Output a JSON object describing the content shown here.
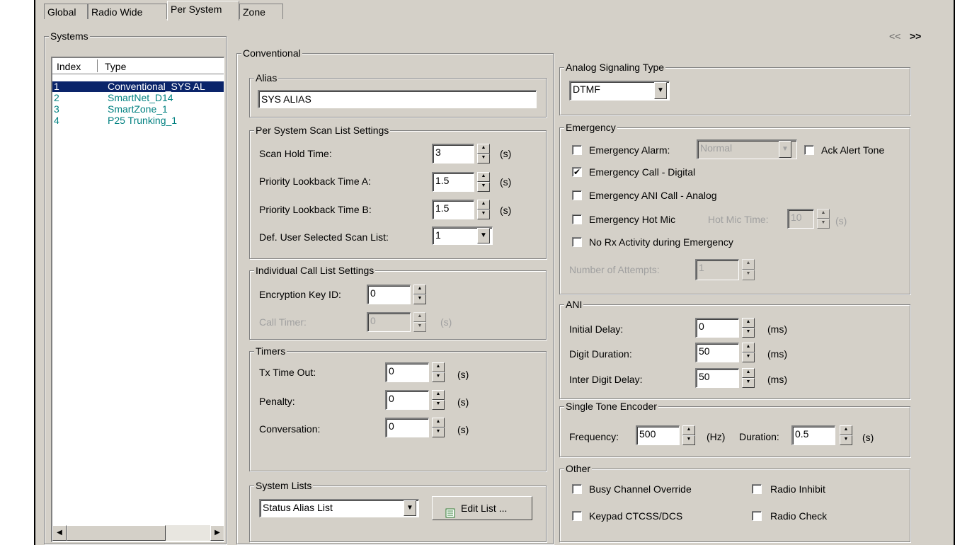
{
  "tabs": [
    "Global",
    "Radio Wide",
    "Per System",
    "Zone"
  ],
  "active_tab": "Per System",
  "nav": {
    "prev": "<<",
    "next": ">>"
  },
  "systems": {
    "title": "Systems",
    "columns": [
      "Index",
      "Type"
    ],
    "rows": [
      {
        "index": "1",
        "type": "Conventional_SYS AL"
      },
      {
        "index": "2",
        "type": "SmartNet_D14"
      },
      {
        "index": "3",
        "type": "SmartZone_1"
      },
      {
        "index": "4",
        "type": "P25 Trunking_1"
      }
    ]
  },
  "conventional": {
    "title": "Conventional",
    "alias": {
      "title": "Alias",
      "value": "SYS ALIAS"
    },
    "scan": {
      "title": "Per System Scan List Settings",
      "hold_label": "Scan Hold Time:",
      "hold_value": "3",
      "hold_unit": "(s)",
      "pa_label": "Priority Lookback Time A:",
      "pa_value": "1.5",
      "pa_unit": "(s)",
      "pb_label": "Priority Lookback Time B:",
      "pb_value": "1.5",
      "pb_unit": "(s)",
      "def_label": "Def. User Selected Scan List:",
      "def_value": "1"
    },
    "individual": {
      "title": "Individual Call List Settings",
      "enc_label": "Encryption Key ID:",
      "enc_value": "0",
      "timer_label": "Call Timer:",
      "timer_value": "0",
      "timer_unit": "(s)"
    },
    "timers": {
      "title": "Timers",
      "tx_label": "Tx Time Out:",
      "tx_value": "0",
      "tx_unit": "(s)",
      "penalty_label": "Penalty:",
      "penalty_value": "0",
      "penalty_unit": "(s)",
      "conv_label": "Conversation:",
      "conv_value": "0",
      "conv_unit": "(s)"
    },
    "lists": {
      "title": "System Lists",
      "select_value": "Status Alias List",
      "edit_label": "Edit List ..."
    }
  },
  "analog": {
    "title": "Analog Signaling Type",
    "value": "DTMF"
  },
  "emergency": {
    "title": "Emergency",
    "alarm_label": "Emergency Alarm:",
    "alarm_value": "Normal",
    "alarm_checked": false,
    "ack_label": "Ack Alert Tone",
    "ack_checked": false,
    "call_digital_label": "Emergency Call - Digital",
    "call_digital_checked": true,
    "ani_analog_label": "Emergency ANI Call - Analog",
    "ani_analog_checked": false,
    "hotmic_label": "Emergency Hot Mic",
    "hotmic_checked": false,
    "hotmic_time_label": "Hot Mic Time:",
    "hotmic_time_value": "10",
    "hotmic_time_unit": "(s)",
    "norx_label": "No Rx Activity during Emergency",
    "norx_checked": false,
    "attempts_label": "Number of Attempts:",
    "attempts_value": "1"
  },
  "ani": {
    "title": "ANI",
    "initial_label": "Initial Delay:",
    "initial_value": "0",
    "initial_unit": "(ms)",
    "digit_label": "Digit Duration:",
    "digit_value": "50",
    "digit_unit": "(ms)",
    "inter_label": "Inter Digit Delay:",
    "inter_value": "50",
    "inter_unit": "(ms)"
  },
  "single_tone": {
    "title": "Single Tone Encoder",
    "freq_label": "Frequency:",
    "freq_value": "500",
    "freq_unit": "(Hz)",
    "dur_label": "Duration:",
    "dur_value": "0.5",
    "dur_unit": "(s)"
  },
  "other": {
    "title": "Other",
    "busy_label": "Busy Channel Override",
    "inhibit_label": "Radio Inhibit",
    "keypad_label": "Keypad CTCSS/DCS",
    "check_label": "Radio Check"
  },
  "glyphs": {
    "check": "✔",
    "up": "▲",
    "down": "▼",
    "left": "◀",
    "right": "▶",
    "dd": "▼"
  }
}
